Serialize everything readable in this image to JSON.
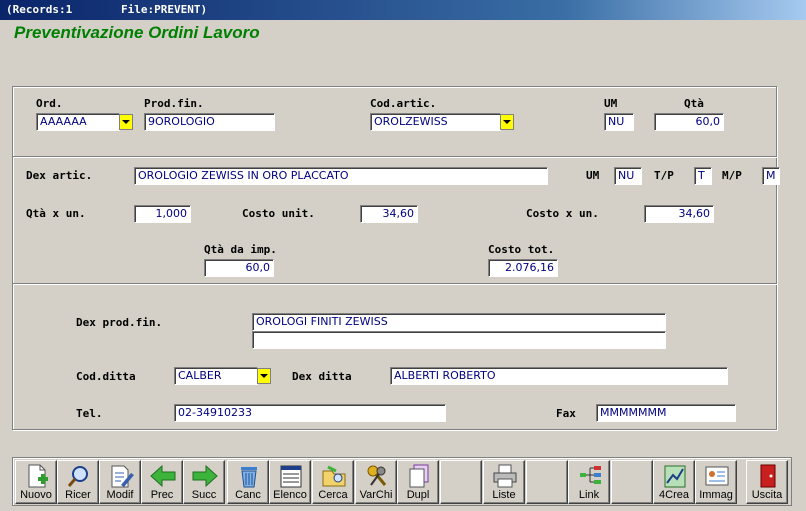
{
  "titlebar": {
    "records": "(Records:1",
    "file": "File:PREVENT)"
  },
  "heading": "Preventivazione Ordini Lavoro",
  "order": {
    "ord_label": "Ord.",
    "ord_value": "AAAAAA",
    "prod_label": "Prod.fin.",
    "prod_value": "9OROLOGIO",
    "cod_label": "Cod.artic.",
    "cod_value": "OROLZEWISS",
    "um_label": "UM",
    "um_value": "NU",
    "qta_label": "Qtà",
    "qta_value": "60,0"
  },
  "article": {
    "dex_label": "Dex artic.",
    "dex_value": "OROLOGIO ZEWISS IN ORO PLACCATO",
    "um_label": "UM",
    "um_value": "NU",
    "tp_label": "T/P",
    "tp_value": "T",
    "mp_label": "M/P",
    "mp_value": "M",
    "qtaun_label": "Qtà x un.",
    "qtaun_value": "1,000",
    "costo_unit_label": "Costo unit.",
    "costo_unit_value": "34,60",
    "costo_xun_label": "Costo x un.",
    "costo_xun_value": "34,60",
    "qta_imp_label": "Qtà da imp.",
    "qta_imp_value": "60,0",
    "costo_tot_label": "Costo tot.",
    "costo_tot_value": "2.076,16"
  },
  "product": {
    "dex_prod_label": "Dex prod.fin.",
    "dex_prod_value1": "OROLOGI FINITI ZEWISS",
    "dex_prod_value2": "",
    "cod_ditta_label": "Cod.ditta",
    "cod_ditta_value": "CALBER",
    "dex_ditta_label": "Dex ditta",
    "dex_ditta_value": "ALBERTI ROBERTO",
    "tel_label": "Tel.",
    "tel_value": "02-34910233",
    "fax_label": "Fax",
    "fax_value": "MMMMMMM"
  },
  "toolbar": [
    {
      "label": "Nuovo",
      "icon": "new-document-icon"
    },
    {
      "label": "Ricer",
      "icon": "magnifier-icon"
    },
    {
      "label": "Modif",
      "icon": "edit-document-icon"
    },
    {
      "label": "Prec",
      "icon": "arrow-left-icon"
    },
    {
      "label": "Succ",
      "icon": "arrow-right-icon"
    },
    {
      "label": "Canc",
      "icon": "trash-icon"
    },
    {
      "label": "Elenco",
      "icon": "list-icon"
    },
    {
      "label": "Cerca",
      "icon": "search-folder-icon"
    },
    {
      "label": "VarChi",
      "icon": "keys-icon"
    },
    {
      "label": "Dupl",
      "icon": "duplicate-icon"
    },
    {
      "label": "",
      "icon": ""
    },
    {
      "label": "Liste",
      "icon": "printer-icon"
    },
    {
      "label": "",
      "icon": ""
    },
    {
      "label": "Link",
      "icon": "link-tree-icon"
    },
    {
      "label": "",
      "icon": ""
    },
    {
      "label": "4Crea",
      "icon": "create-chart-icon"
    },
    {
      "label": "Immag",
      "icon": "image-card-icon"
    },
    {
      "label": "Uscita",
      "icon": "exit-door-icon"
    }
  ],
  "colors": {
    "field_text": "#000080",
    "heading": "#008000",
    "combo_button": "#ffff00"
  }
}
